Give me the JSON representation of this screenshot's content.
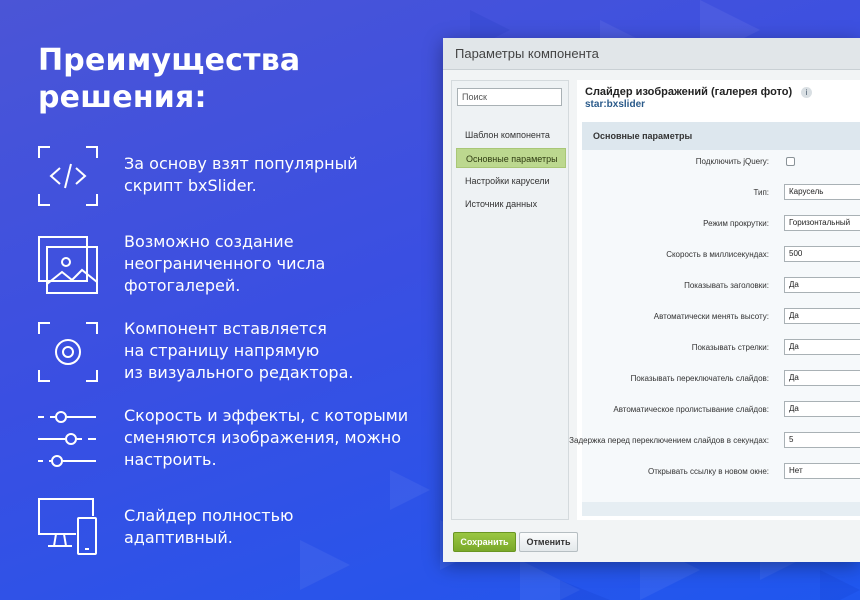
{
  "headline": [
    "Преимущества",
    "решения:"
  ],
  "features": [
    {
      "icon": "code-icon",
      "lines": [
        "За основу взят популярный",
        "скрипт bxSlider."
      ]
    },
    {
      "icon": "gallery-icon",
      "lines": [
        "Возможно создание",
        "неограниченного числа",
        "фотогалерей."
      ]
    },
    {
      "icon": "target-icon",
      "lines": [
        "Компонент вставляется",
        "на страницу напрямую",
        "из визуального редактора."
      ]
    },
    {
      "icon": "sliders-icon",
      "lines": [
        "Скорость и эффекты, с которыми",
        "сменяются изображения, можно",
        "настроить."
      ]
    },
    {
      "icon": "devices-icon",
      "lines": [
        "Слайдер полностью",
        "адаптивный."
      ]
    }
  ],
  "dialog": {
    "title": "Параметры компонента",
    "search_placeholder": "Поиск",
    "nav": [
      {
        "label": "Шаблон компонента",
        "active": false
      },
      {
        "label": "Основные параметры",
        "active": true
      },
      {
        "label": "Настройки карусели",
        "active": false
      },
      {
        "label": "Источник данных",
        "active": false
      }
    ],
    "component_title": "Слайдер изображений (галерея фото)",
    "component_id": "star:bxslider",
    "info_glyph": "i",
    "section_title": "Основные параметры",
    "fields": [
      {
        "label": "Подключить jQuery:",
        "type": "checkbox",
        "value": ""
      },
      {
        "label": "Тип:",
        "type": "select",
        "value": "Карусель"
      },
      {
        "label": "Режим прокрутки:",
        "type": "select",
        "value": "Горизонтальный"
      },
      {
        "label": "Скорость в миллисекундах:",
        "type": "text",
        "value": "500"
      },
      {
        "label": "Показывать заголовки:",
        "type": "select",
        "value": "Да"
      },
      {
        "label": "Автоматически менять высоту:",
        "type": "select",
        "value": "Да"
      },
      {
        "label": "Показывать стрелки:",
        "type": "select",
        "value": "Да"
      },
      {
        "label": "Показывать переключатель слайдов:",
        "type": "select",
        "value": "Да"
      },
      {
        "label": "Автоматическое пролистывание слайдов:",
        "type": "select",
        "value": "Да"
      },
      {
        "label": "Задержка перед переключением слайдов в секундах:",
        "type": "text",
        "value": "5"
      },
      {
        "label": "Открывать ссылку в новом окне:",
        "type": "select",
        "value": "Нет"
      }
    ],
    "save_label": "Сохранить",
    "cancel_label": "Отменить"
  },
  "colors": {
    "accent_green": "#8bbb36",
    "background_blue": "#2a55e8",
    "background_purple": "#4b55d6"
  }
}
